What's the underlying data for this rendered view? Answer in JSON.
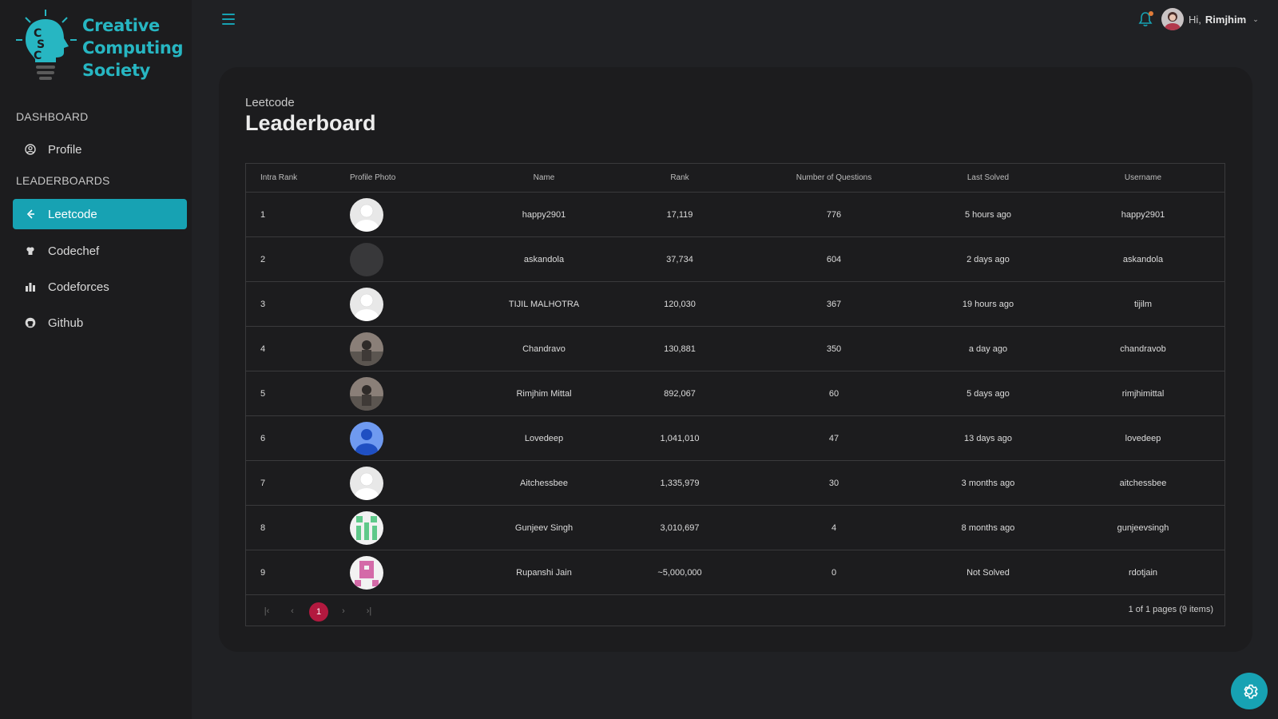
{
  "brand": {
    "line1": "Creative",
    "line2": "Computing",
    "line3": "Society",
    "accent_color": "#17a2b3"
  },
  "sidebar": {
    "sections": [
      {
        "label": "DASHBOARD",
        "items": [
          {
            "label": "Profile",
            "icon": "user-circle-icon"
          }
        ]
      },
      {
        "label": "LEADERBOARDS",
        "items": [
          {
            "label": "Leetcode",
            "icon": "leetcode-icon",
            "active": true
          },
          {
            "label": "Codechef",
            "icon": "chef-hat-icon"
          },
          {
            "label": "Codeforces",
            "icon": "bar-chart-icon"
          },
          {
            "label": "Github",
            "icon": "github-icon"
          }
        ]
      }
    ]
  },
  "header": {
    "greeting": "Hi,",
    "username": "Rimjhim",
    "notification_dot_color": "#e07b39"
  },
  "page": {
    "subtitle": "Leetcode",
    "title": "Leaderboard"
  },
  "table": {
    "columns": [
      "Intra Rank",
      "Profile Photo",
      "Name",
      "Rank",
      "Number of Questions",
      "Last Solved",
      "Username"
    ],
    "rows": [
      {
        "intra_rank": "1",
        "photo": "default-avatar",
        "name": "happy2901",
        "rank": "17,119",
        "questions": "776",
        "last_solved": "5 hours ago",
        "username": "happy2901"
      },
      {
        "intra_rank": "2",
        "photo": "blank-dark-avatar",
        "name": "askandola",
        "rank": "37,734",
        "questions": "604",
        "last_solved": "2 days ago",
        "username": "askandola"
      },
      {
        "intra_rank": "3",
        "photo": "default-avatar",
        "name": "TIJIL MALHOTRA",
        "rank": "120,030",
        "questions": "367",
        "last_solved": "19 hours ago",
        "username": "tijilm"
      },
      {
        "intra_rank": "4",
        "photo": "photo-avatar",
        "name": "Chandravo",
        "rank": "130,881",
        "questions": "350",
        "last_solved": "a day ago",
        "username": "chandravob"
      },
      {
        "intra_rank": "5",
        "photo": "photo-avatar",
        "name": "Rimjhim Mittal",
        "rank": "892,067",
        "questions": "60",
        "last_solved": "5 days ago",
        "username": "rimjhimittal"
      },
      {
        "intra_rank": "6",
        "photo": "blue-person-avatar",
        "name": "Lovedeep",
        "rank": "1,041,010",
        "questions": "47",
        "last_solved": "13 days ago",
        "username": "lovedeep"
      },
      {
        "intra_rank": "7",
        "photo": "default-avatar",
        "name": "Aitchessbee",
        "rank": "1,335,979",
        "questions": "30",
        "last_solved": "3 months ago",
        "username": "aitchessbee"
      },
      {
        "intra_rank": "8",
        "photo": "green-identicon-avatar",
        "name": "Gunjeev Singh",
        "rank": "3,010,697",
        "questions": "4",
        "last_solved": "8 months ago",
        "username": "gunjeevsingh"
      },
      {
        "intra_rank": "9",
        "photo": "pink-identicon-avatar",
        "name": "Rupanshi Jain",
        "rank": "~5,000,000",
        "questions": "0",
        "last_solved": "Not Solved",
        "username": "rdotjain"
      }
    ]
  },
  "pagination": {
    "current_page": "1",
    "info": "1 of 1 pages (9 items)",
    "active_color": "#b3193f"
  }
}
